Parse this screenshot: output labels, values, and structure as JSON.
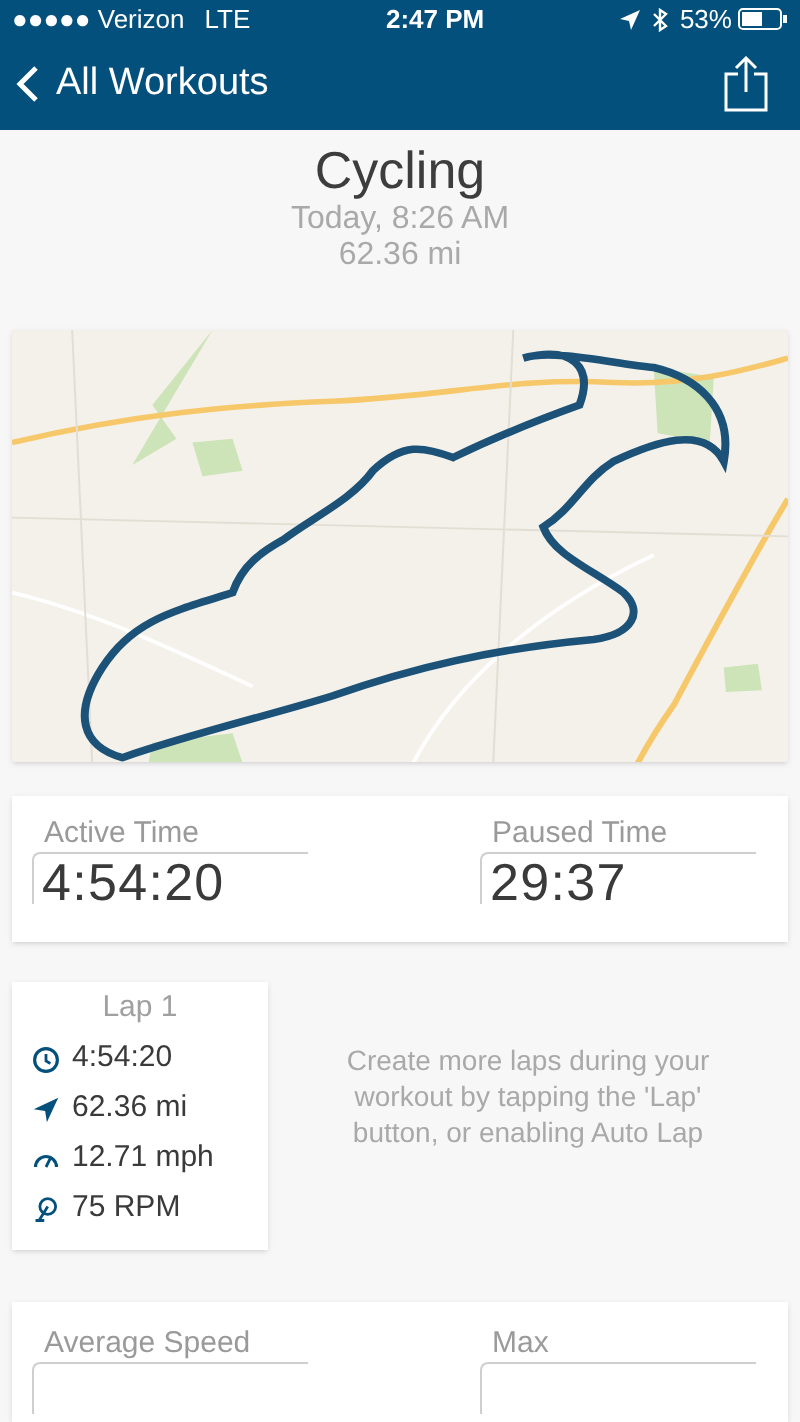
{
  "status_bar": {
    "carrier": "●●●●● Verizon",
    "network": "LTE",
    "time": "2:47 PM",
    "battery": "53%"
  },
  "nav": {
    "back_label": "All Workouts"
  },
  "workout": {
    "title": "Cycling",
    "date": "Today, 8:26 AM",
    "distance": "62.36 mi"
  },
  "time_stats": [
    {
      "label": "Active Time",
      "value": "4:54:20"
    },
    {
      "label": "Paused Time",
      "value": "29:37"
    }
  ],
  "lap": {
    "title": "Lap 1",
    "rows": [
      {
        "kind": "time",
        "value": "4:54:20"
      },
      {
        "kind": "distance",
        "value": "62.36 mi"
      },
      {
        "kind": "speed",
        "value": "12.71 mph"
      },
      {
        "kind": "cadence",
        "value": "75 RPM"
      }
    ]
  },
  "lap_hint": "Create more laps during your workout by tapping the 'Lap' button, or enabling Auto Lap",
  "speed_stats": [
    {
      "label": "Average Speed"
    },
    {
      "label": "Max"
    }
  ]
}
